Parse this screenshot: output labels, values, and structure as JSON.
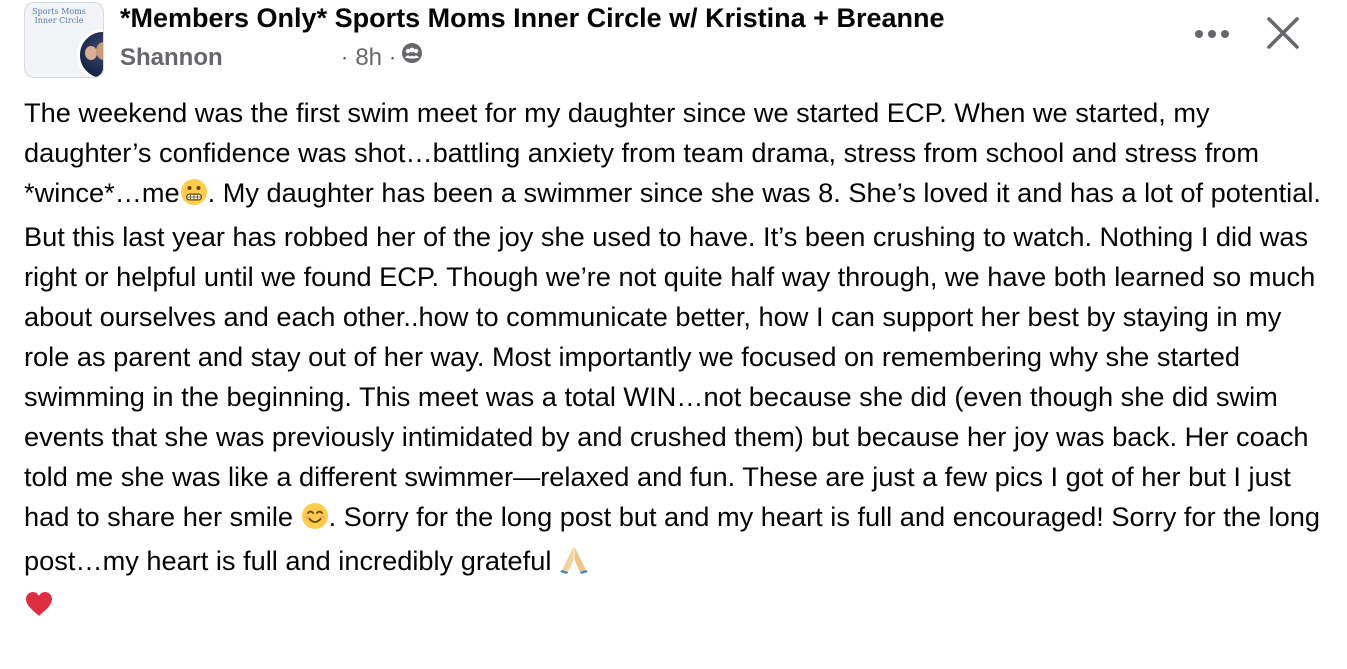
{
  "post": {
    "group_name": "*Members Only* Sports Moms Inner Circle w/ Kristina + Breanne",
    "group_avatar_text": "Sports Moms Inner Circle",
    "author": "Shannon",
    "time": "· 8h ·",
    "privacy_icon": "group-members-icon",
    "body": [
      {
        "text": "The weekend was the first swim meet for my daughter since we started ECP. When we started, my daughter’s confidence was shot…battling anxiety from team drama, stress from school and stress from *wince*…me"
      },
      {
        "emoji": "grimacing-face"
      },
      {
        "text": ". My daughter has been a swimmer since she was 8. She’s loved it and has a lot of potential. But this last year has robbed her of the joy she used to have. It’s been crushing to watch. Nothing I did was right or helpful until we found ECP. Though we’re not quite half way through, we have both learned so much about ourselves and each other..how to communicate better, how I can support her best by staying in my role as parent and stay out of her way. Most importantly we focused on remembering why she started swimming in the beginning. This meet was a total WIN…not because she did (even though she did swim events that she was previously intimidated by and crushed them) but because her joy was back. Her coach told me she was like a different swimmer—relaxed and fun. These are just a few pics I got of her but I just had to share her smile "
      },
      {
        "emoji": "smiling-face"
      },
      {
        "text": ". Sorry for the long post but and my heart is full and encouraged! Sorry for the long post…my heart is full and incredibly grateful "
      },
      {
        "emoji": "folded-hands"
      },
      {
        "emoji": "red-heart"
      }
    ]
  },
  "colors": {
    "text": "#050505",
    "secondary": "#65676b",
    "heart": "#e0245e"
  },
  "icons": {
    "more": "more-horizontal-icon",
    "close": "close-icon"
  }
}
